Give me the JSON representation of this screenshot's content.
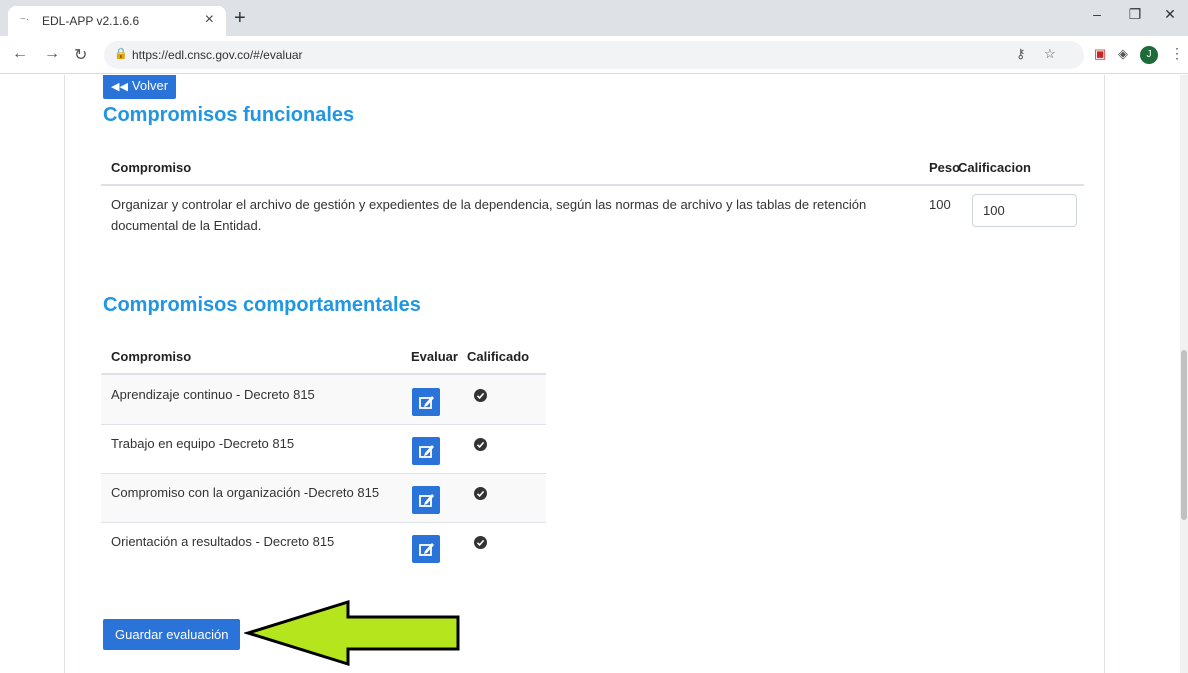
{
  "browser": {
    "tab_title": "EDL-APP v2.1.6.6",
    "tab_close": "×",
    "new_tab": "+",
    "url": "https://edl.cnsc.gov.co/#/evaluar",
    "avatar_initial": "J",
    "icons": {
      "minimize": "minimize-icon",
      "maximize": "maximize-icon",
      "close": "close-icon",
      "back": "back-arrow-icon",
      "forward": "forward-arrow-icon",
      "reload": "reload-icon",
      "lock": "lock-icon",
      "key": "key-icon",
      "star": "star-icon",
      "extension1": "shield-extension-icon",
      "extension2": "s-extension-icon",
      "menu": "kebab-menu-icon"
    }
  },
  "page": {
    "back_button": "Volver",
    "functional": {
      "title": "Compromisos funcionales",
      "headers": {
        "compromiso": "Compromiso",
        "peso": "Peso",
        "calificacion": "Calificacion"
      },
      "rows": [
        {
          "compromiso_line1": "Organizar y controlar el archivo de gestión y expedientes de la dependencia, según las normas de archivo y las tablas de retención",
          "compromiso_line2": "documental de la Entidad.",
          "peso": "100",
          "calificacion": "100"
        }
      ]
    },
    "behavioral": {
      "title": "Compromisos comportamentales",
      "headers": {
        "compromiso": "Compromiso",
        "evaluar": "Evaluar",
        "calificado": "Calificado"
      },
      "rows": [
        {
          "compromiso": "Aprendizaje continuo - Decreto 815",
          "calificado": true
        },
        {
          "compromiso": "Trabajo en equipo -Decreto 815",
          "calificado": true
        },
        {
          "compromiso": "Compromiso con la organización -Decreto 815",
          "calificado": true
        },
        {
          "compromiso": "Orientación a resultados - Decreto 815",
          "calificado": true
        }
      ]
    },
    "save_button": "Guardar evaluación"
  },
  "colors": {
    "primary": "#2a73d8",
    "title": "#2196e3",
    "arrow_fill": "#b5e61d"
  }
}
